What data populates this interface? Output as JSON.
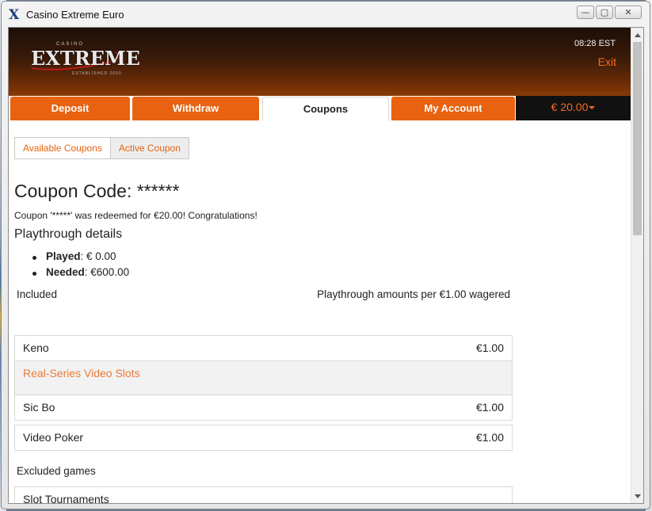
{
  "window": {
    "title": "Casino Extreme Euro",
    "app_icon": "X",
    "minimize_glyph": "—",
    "maximize_glyph": "▢",
    "close_glyph": "✕"
  },
  "header": {
    "logo": {
      "casino": "CASINO",
      "extreme": "EXTREME",
      "established": "ESTABLISHED 2000"
    },
    "time": "08:28 EST",
    "exit_label": "Exit"
  },
  "tabs": [
    {
      "label": "Deposit"
    },
    {
      "label": "Withdraw"
    },
    {
      "label": "Coupons",
      "active": true
    },
    {
      "label": "My Account"
    }
  ],
  "balance": "€ 20.00",
  "subtabs": [
    {
      "label": "Available Coupons"
    },
    {
      "label": "Active Coupon",
      "active": true
    }
  ],
  "coupon": {
    "code_heading": "Coupon Code: ******",
    "redeem_message": "Coupon '*****' was redeemed for €20.00! Congratulations!",
    "playthrough_heading": "Playthrough details",
    "played_label": "Played",
    "played_value": ": € 0.00",
    "needed_label": "Needed",
    "needed_value": ": €600.00"
  },
  "included": {
    "heading": "Included",
    "amounts_heading": "Playthrough amounts per €1.00 wagered",
    "rows": [
      {
        "name": "Keno",
        "amount": "€1.00"
      },
      {
        "name": "Real-Series Video Slots",
        "amount": ""
      },
      {
        "name": "Sic Bo",
        "amount": "€1.00"
      },
      {
        "name": "Video Poker",
        "amount": "€1.00"
      }
    ]
  },
  "excluded": {
    "heading": "Excluded games",
    "rows": [
      {
        "name": "Slot Tournaments"
      }
    ]
  },
  "colors": {
    "accent": "#e8620f",
    "header_dark": "#1b0f08",
    "balance_bg": "#111111"
  }
}
